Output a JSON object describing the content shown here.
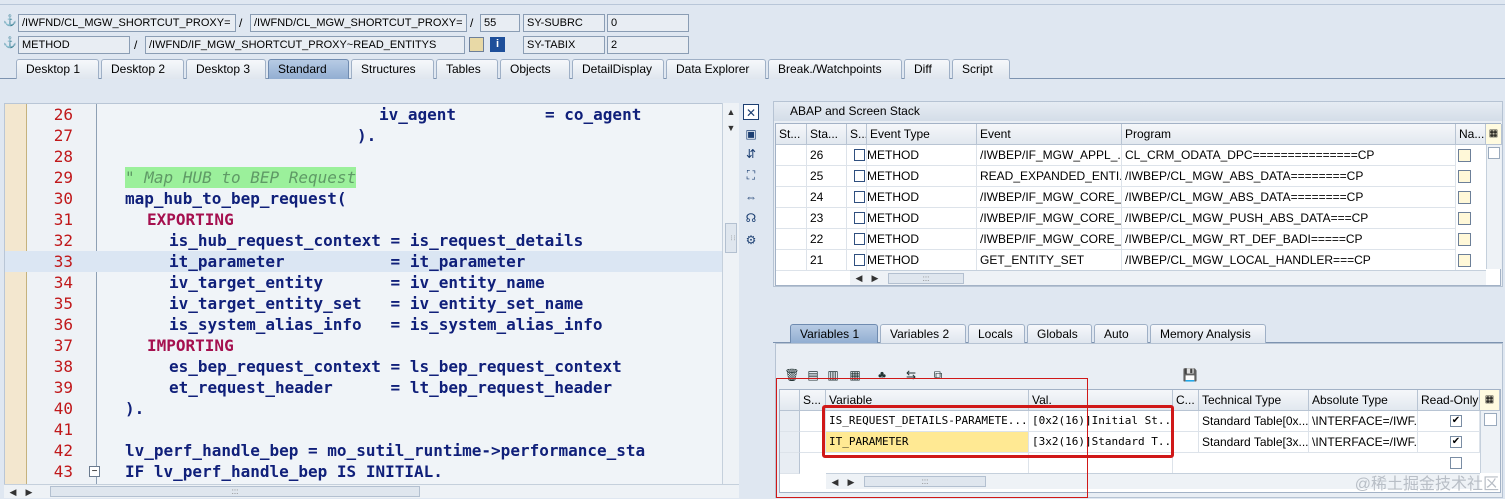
{
  "header": {
    "row1": {
      "field_a": "/IWFND/CL_MGW_SHORTCUT_PROXY=",
      "sep_a": "/",
      "field_b": "/IWFND/CL_MGW_SHORTCUT_PROXY=",
      "sep_b": "/",
      "field_c": "55",
      "label": "SY-SUBRC",
      "value": "0"
    },
    "row2": {
      "field_a": "METHOD",
      "sep_a": "/",
      "field_b": "/IWFND/IF_MGW_SHORTCUT_PROXY~READ_ENTITYS",
      "label": "SY-TABIX",
      "value": "2"
    }
  },
  "main_tabs": [
    "Desktop 1",
    "Desktop 2",
    "Desktop 3",
    "Standard",
    "Structures",
    "Tables",
    "Objects",
    "DetailDisplay",
    "Data Explorer",
    "Break./Watchpoints",
    "Diff",
    "Script"
  ],
  "active_main_tab": "Standard",
  "editor": {
    "lines": [
      {
        "n": "26",
        "t": "iv_agent"
      },
      {
        "n": "27",
        "t": ")."
      },
      {
        "n": "28",
        "t": ""
      },
      {
        "n": "29",
        "t": "\" Map HUB to BEP Request"
      },
      {
        "n": "30",
        "t": "map_hub_to_bep_request("
      },
      {
        "n": "31",
        "t": "EXPORTING"
      },
      {
        "n": "32",
        "t": "is_hub_request_context = is_request_details"
      },
      {
        "n": "33",
        "t": "it_parameter           = it_parameter"
      },
      {
        "n": "34",
        "t": "iv_target_entity       = iv_entity_name"
      },
      {
        "n": "35",
        "t": "iv_target_entity_set   = iv_entity_set_name"
      },
      {
        "n": "36",
        "t": "is_system_alias_info   = is_system_alias_info"
      },
      {
        "n": "37",
        "t": "IMPORTING"
      },
      {
        "n": "38",
        "t": "es_bep_request_context = ls_bep_request_context"
      },
      {
        "n": "39",
        "t": "et_request_header      = lt_bep_request_header"
      },
      {
        "n": "40",
        "t": ")."
      },
      {
        "n": "41",
        "t": ""
      },
      {
        "n": "42",
        "t": "lv_perf_handle_bep = mo_sutil_runtime->performance_sta"
      },
      {
        "n": "43",
        "t": "IF lv_perf_handle_bep IS INITIAL."
      }
    ],
    "line26_rhs": "= co_agent"
  },
  "stack": {
    "title": "ABAP and Screen Stack",
    "columns": [
      "St...",
      "Sta...",
      "S...",
      "Event Type",
      "Event",
      "Program",
      "Na..."
    ],
    "rows": [
      {
        "stack": "26",
        "type": "METHOD",
        "event": "/IWBEP/IF_MGW_APPL_...",
        "program": "CL_CRM_ODATA_DPC===============CP"
      },
      {
        "stack": "25",
        "type": "METHOD",
        "event": "READ_EXPANDED_ENTI...",
        "program": "/IWBEP/CL_MGW_ABS_DATA========CP"
      },
      {
        "stack": "24",
        "type": "METHOD",
        "event": "/IWBEP/IF_MGW_CORE_...",
        "program": "/IWBEP/CL_MGW_ABS_DATA========CP"
      },
      {
        "stack": "23",
        "type": "METHOD",
        "event": "/IWBEP/IF_MGW_CORE_...",
        "program": "/IWBEP/CL_MGW_PUSH_ABS_DATA===CP"
      },
      {
        "stack": "22",
        "type": "METHOD",
        "event": "/IWBEP/IF_MGW_CORE_...",
        "program": "/IWBEP/CL_MGW_RT_DEF_BADI=====CP"
      },
      {
        "stack": "21",
        "type": "METHOD",
        "event": "GET_ENTITY_SET",
        "program": "/IWBEP/CL_MGW_LOCAL_HANDLER===CP"
      }
    ],
    "scroll_marker": ":::"
  },
  "var_tabs": [
    "Variables 1",
    "Variables 2",
    "Locals",
    "Globals",
    "Auto",
    "Memory Analysis"
  ],
  "active_var_tab": "Variables 1",
  "variables": {
    "columns": [
      "S...",
      "Variable",
      "Val.",
      "C...",
      "Technical Type",
      "Absolute Type",
      "Read-Only"
    ],
    "rows": [
      {
        "variable": "IS_REQUEST_DETAILS-PARAMETE...",
        "value": "[0x2(16)]Initial St...",
        "tech": "Standard Table[0x...",
        "abs": "\\INTERFACE=/IWF...",
        "readonly": true
      },
      {
        "variable": "IT_PARAMETER",
        "value": "[3x2(16)]Standard T...",
        "tech": "Standard Table[3x...",
        "abs": "\\INTERFACE=/IWF...",
        "readonly": true
      }
    ],
    "scroll_marker": ":::"
  },
  "scroll_markers": {
    "editor_h": ":::",
    "editor_v": ":::"
  },
  "watermark": "@稀土掘金技术社区",
  "colors": {
    "accent": "#92aed2",
    "highlight": "#ffe993",
    "red_box": "#d01818",
    "keyword": "#a5104f",
    "line_number": "#c0181a"
  }
}
